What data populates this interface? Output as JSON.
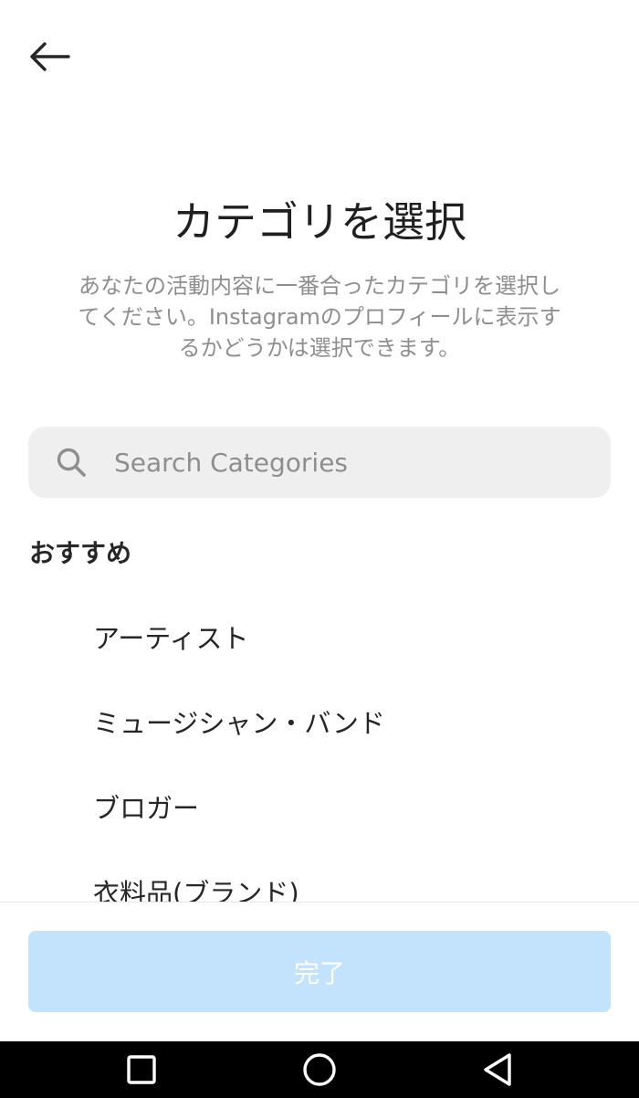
{
  "header": {
    "back_icon": "arrow-left-icon"
  },
  "title": "カテゴリを選択",
  "subtitle_lines": [
    "あなたの活動内容に一番合ったカテゴリを選択し",
    "てください。Instagramのプロフィールに表示す",
    "るかどうかは選択できます。"
  ],
  "search": {
    "placeholder": "Search Categories",
    "value": "",
    "icon": "search-icon"
  },
  "section": {
    "heading": "おすすめ"
  },
  "categories": [
    {
      "label": "アーティスト"
    },
    {
      "label": "ミュージシャン・バンド"
    },
    {
      "label": "ブロガー"
    },
    {
      "label": "衣料品(ブランド)"
    }
  ],
  "footer": {
    "done_label": "完了"
  },
  "navbar": {
    "icons": [
      "recents-square-icon",
      "home-circle-icon",
      "back-triangle-icon"
    ]
  },
  "colors": {
    "done_button_disabled": "#c2e3fb",
    "search_bg": "#efefef",
    "secondary_text": "#8e8e8e"
  }
}
